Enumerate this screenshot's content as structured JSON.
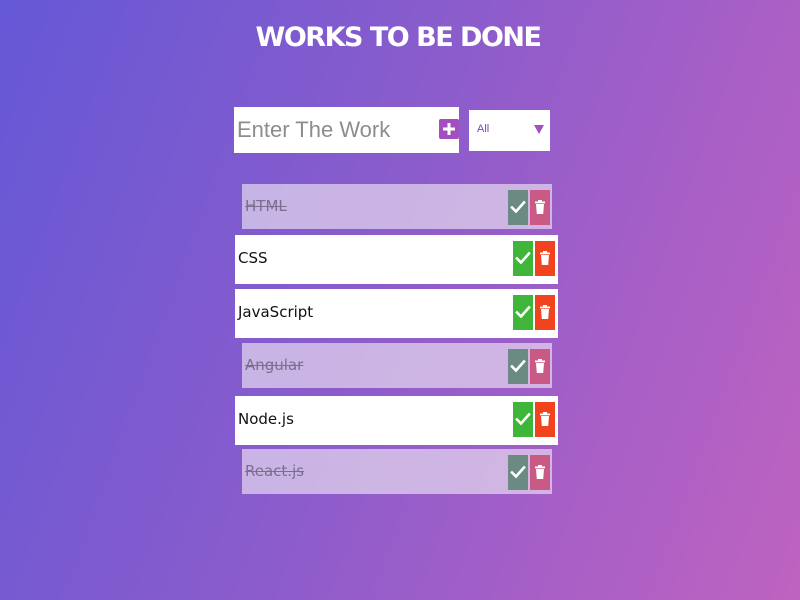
{
  "header": {
    "title": "WORKS TO BE DONE"
  },
  "form": {
    "placeholder": "Enter The Work",
    "value": "",
    "add_icon": "plus-square-icon",
    "filter": {
      "selected": "All",
      "icon": "triangle-down-icon"
    }
  },
  "todos": [
    {
      "text": "HTML",
      "completed": true
    },
    {
      "text": "CSS",
      "completed": false
    },
    {
      "text": "JavaScript",
      "completed": false
    },
    {
      "text": "Angular",
      "completed": true
    },
    {
      "text": "Node.js",
      "completed": false
    },
    {
      "text": "React.js",
      "completed": true
    }
  ],
  "icons": {
    "complete": "check-icon",
    "delete": "trash-icon"
  },
  "colors": {
    "background_start": "#6558d6",
    "background_end": "#be63c0",
    "accent": "#a34fc0",
    "complete_button": "#3fb53a",
    "delete_button": "#f2431f",
    "complete_button_dimmed": "#6b8a84",
    "delete_button_dimmed": "#c95a86"
  }
}
